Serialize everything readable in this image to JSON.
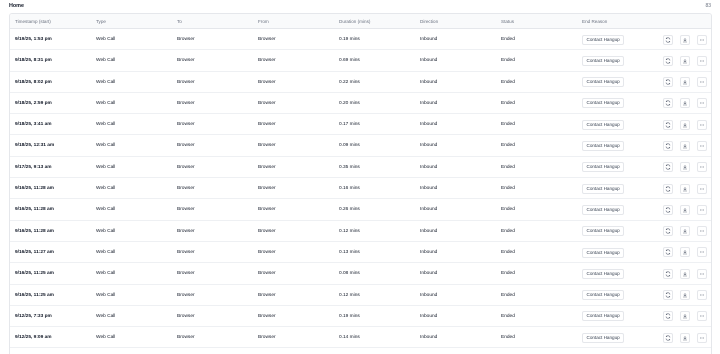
{
  "header": {
    "breadcrumb": "Home",
    "count": "83"
  },
  "table": {
    "columns": [
      "Timestamp (start)",
      "Type",
      "To",
      "From",
      "Duration (mins)",
      "Direction",
      "Status",
      "End Reason"
    ],
    "rows": [
      [
        "9/19/25, 1:53 pm",
        "Web Call",
        "Browser",
        "Browser",
        "0.19 mins",
        "Inbound",
        "Ended",
        "Contact Hangup"
      ],
      [
        "9/18/25, 8:31 pm",
        "Web Call",
        "Browser",
        "Browser",
        "0.69 mins",
        "Inbound",
        "Ended",
        "Contact Hangup"
      ],
      [
        "9/18/25, 8:02 pm",
        "Web Call",
        "Browser",
        "Browser",
        "0.22 mins",
        "Inbound",
        "Ended",
        "Contact Hangup"
      ],
      [
        "9/18/25, 2:59 pm",
        "Web Call",
        "Browser",
        "Browser",
        "0.20 mins",
        "Inbound",
        "Ended",
        "Contact Hangup"
      ],
      [
        "9/18/25, 3:41 am",
        "Web Call",
        "Browser",
        "Browser",
        "0.17 mins",
        "Inbound",
        "Ended",
        "Contact Hangup"
      ],
      [
        "9/18/25, 12:31 am",
        "Web Call",
        "Browser",
        "Browser",
        "0.09 mins",
        "Inbound",
        "Ended",
        "Contact Hangup"
      ],
      [
        "9/17/25, 9:13 am",
        "Web Call",
        "Browser",
        "Browser",
        "0.35 mins",
        "Inbound",
        "Ended",
        "Contact Hangup"
      ],
      [
        "9/16/25, 11:28 am",
        "Web Call",
        "Browser",
        "Browser",
        "0.16 mins",
        "Inbound",
        "Ended",
        "Contact Hangup"
      ],
      [
        "9/16/25, 11:28 am",
        "Web Call",
        "Browser",
        "Browser",
        "0.26 mins",
        "Inbound",
        "Ended",
        "Contact Hangup"
      ],
      [
        "9/16/25, 11:28 am",
        "Web Call",
        "Browser",
        "Browser",
        "0.12 mins",
        "Inbound",
        "Ended",
        "Contact Hangup"
      ],
      [
        "9/16/25, 11:27 am",
        "Web Call",
        "Browser",
        "Browser",
        "0.13 mins",
        "Inbound",
        "Ended",
        "Contact Hangup"
      ],
      [
        "9/16/25, 11:25 am",
        "Web Call",
        "Browser",
        "Browser",
        "0.08 mins",
        "Inbound",
        "Ended",
        "Contact Hangup"
      ],
      [
        "9/16/25, 11:25 am",
        "Web Call",
        "Browser",
        "Browser",
        "0.12 mins",
        "Inbound",
        "Ended",
        "Contact Hangup"
      ],
      [
        "9/12/25, 7:33 pm",
        "Web Call",
        "Browser",
        "Browser",
        "0.19 mins",
        "Inbound",
        "Ended",
        "Contact Hangup"
      ],
      [
        "9/12/25, 9:09 am",
        "Web Call",
        "Browser",
        "Browser",
        "0.14 mins",
        "Inbound",
        "Ended",
        "Contact Hangup"
      ],
      [
        "",
        "",
        "",
        "",
        "",
        "",
        "",
        ""
      ]
    ],
    "row_actions": [
      "refresh-icon",
      "download-icon",
      "more-horizontal-icon"
    ]
  },
  "colors": {
    "border": "#e5e7eb",
    "header_bg": "#f9fafb",
    "muted_text": "#6b7280",
    "text": "#111827"
  }
}
